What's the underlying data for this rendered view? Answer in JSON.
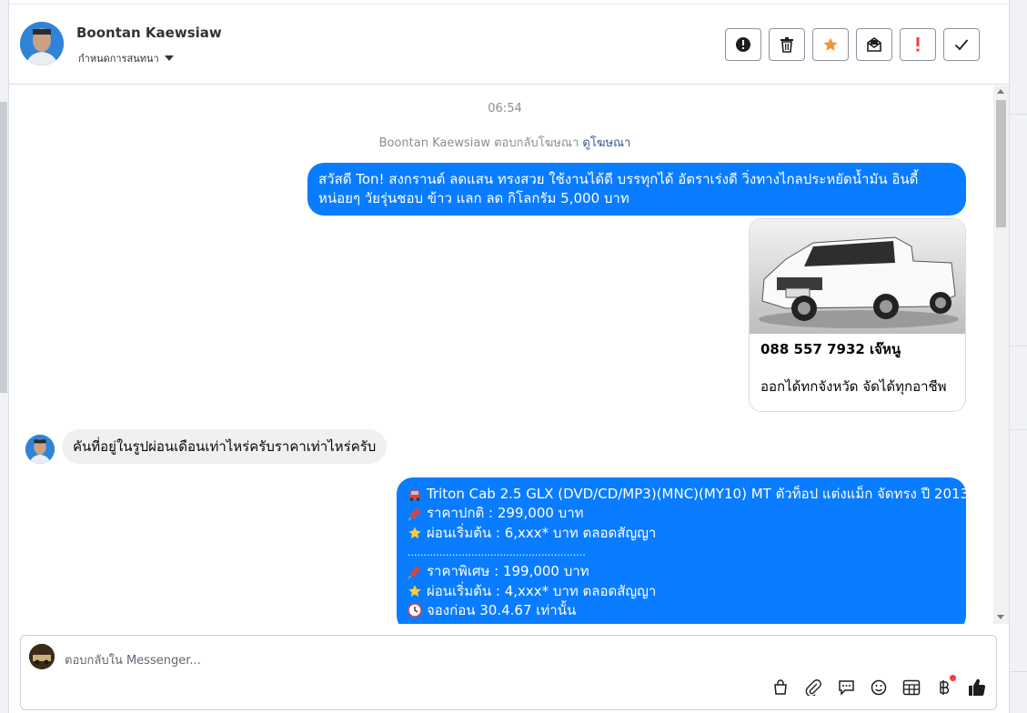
{
  "header": {
    "contact_name": "Boontan Kaewsiaw",
    "conversation_settings": "กำหนดการสนทนา"
  },
  "header_actions": [
    "mark-spam",
    "delete",
    "star",
    "mark-unread",
    "important",
    "done"
  ],
  "colors": {
    "accent": "#0a7cff",
    "star": "#f7923b",
    "important": "#fa383e"
  },
  "chat": {
    "timestamp": "06:54",
    "ad_reply_text": "Boontan Kaewsiaw ตอบกลับโฆษณา",
    "ad_reply_link": "ดูโฆษณา",
    "message1": "สวัสดี Ton! สงกรานต์ ลดแสน ทรงสวย ใช้งานได้ดี บรรทุกได้ อัตราเร่งดี วิ่งทางไกลประหยัดน้ำมัน อินดี้ หน่อยๆ วัยรุ่นชอบ ข้าว แลก ลด กิโลกรัม 5,000 บาท",
    "card": {
      "title": "088 557 7932 เจ๊หนู",
      "description": "ออกได้ทกจังหวัด จัดได้ทุกอาชีพ"
    },
    "incoming": "คันที่อยู่ในรูปผ่อนเดือนเท่าไหร่ครับราคาเท่าไหร่ครับ",
    "message2_lines": [
      {
        "icon": "car-icon",
        "text": "Triton Cab 2.5 GLX (DVD/CD/MP3)(MNC)(MY10) MT ตัวท็อป แต่งแม็ก จัดทรง ปี 2013"
      },
      {
        "icon": "pushpin-icon",
        "text": "ราคาปกติ : 299,000 บาท"
      },
      {
        "icon": "star-icon",
        "text": "ผ่อนเริ่มต้น : 6,xxx* บาท ตลอดสัญญา"
      },
      {
        "icon": "",
        "text": "........................................................"
      },
      {
        "icon": "pushpin-icon",
        "text": "ราคาพิเศษ : 199,000 บาท"
      },
      {
        "icon": "star-icon",
        "text": "ผ่อนเริ่มต้น : 4,xxx* บาท ตลอดสัญญา"
      },
      {
        "icon": "clock-icon",
        "text": "จองก่อน 30.4.67 เท่านั้น"
      }
    ]
  },
  "composer": {
    "placeholder": "ตอบกลับใน Messenger..."
  },
  "composer_tools": [
    "shop",
    "attach",
    "saved-replies",
    "emoji",
    "table",
    "baht",
    "like"
  ]
}
